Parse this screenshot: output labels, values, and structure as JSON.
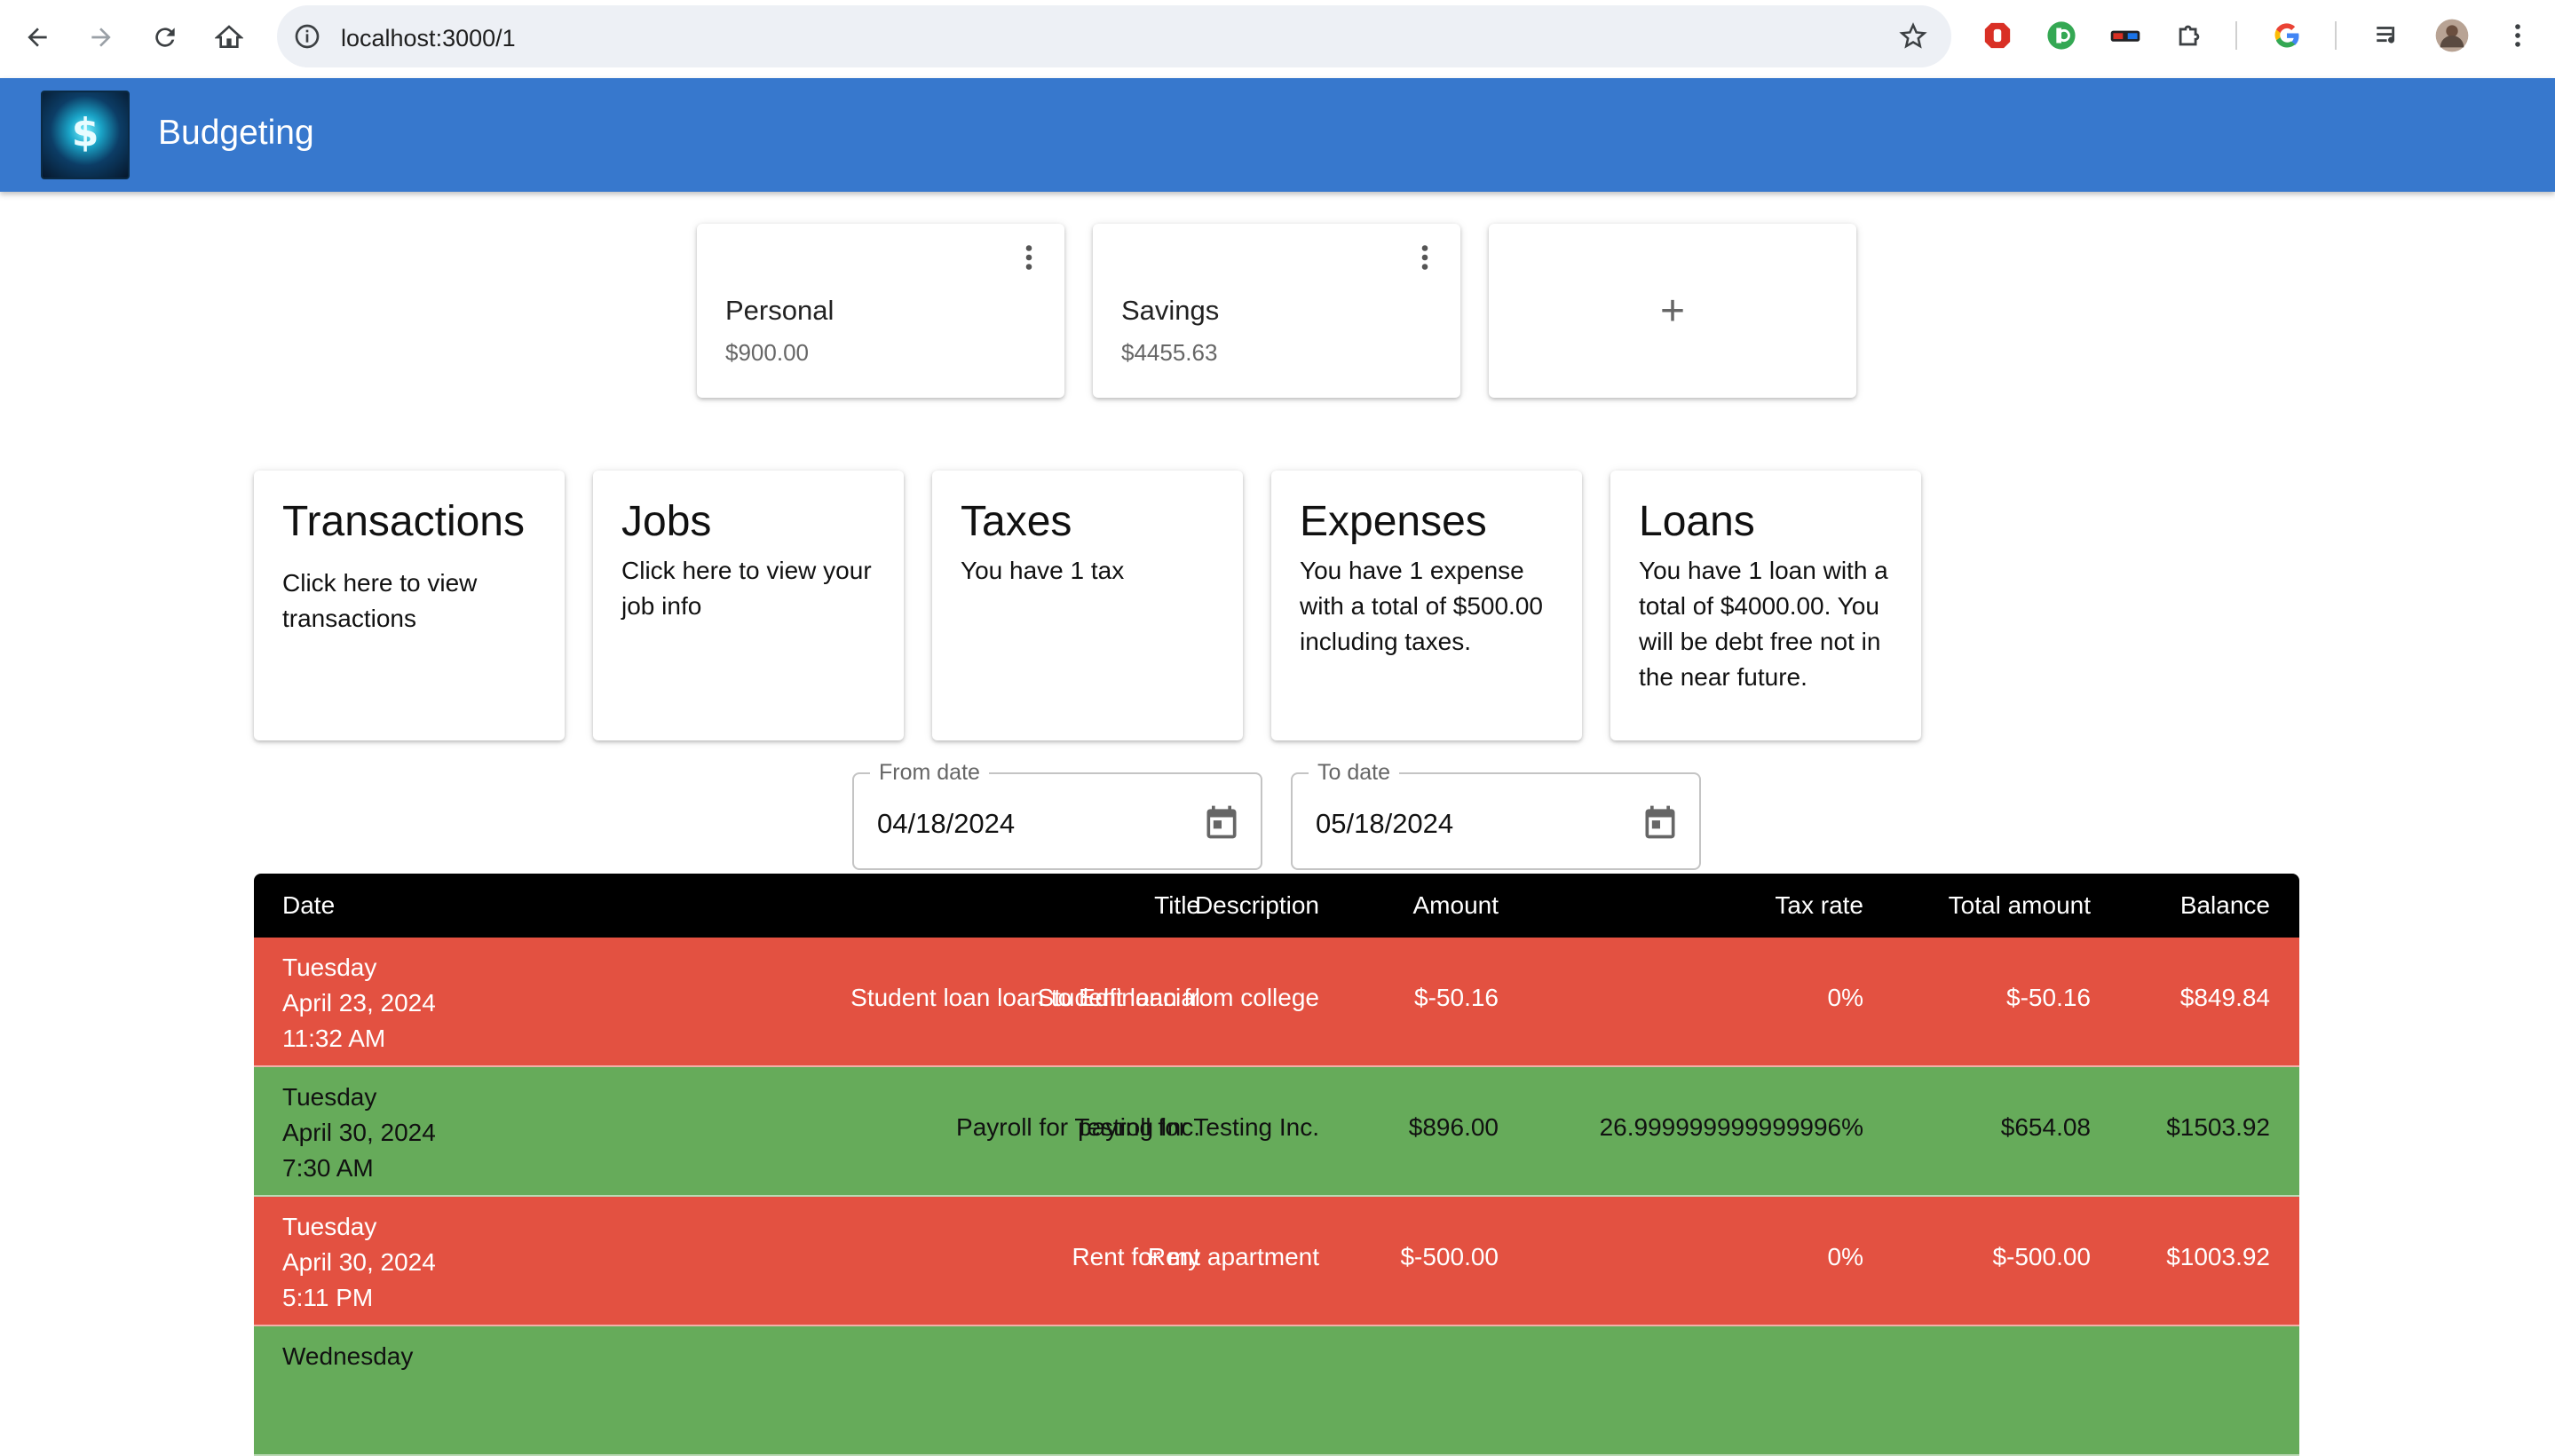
{
  "browser": {
    "url": "localhost:3000/1"
  },
  "app": {
    "title": "Budgeting",
    "logo_icon": "crystal-ball-dollar-logo"
  },
  "accounts": [
    {
      "name": "Personal",
      "balance": "$900.00"
    },
    {
      "name": "Savings",
      "balance": "$4455.63"
    }
  ],
  "add_account_label": "+",
  "sections": {
    "transactions": {
      "title": "Transactions",
      "text": "Click here to view transactions"
    },
    "jobs": {
      "title": "Jobs",
      "text": "Click here to view your job info"
    },
    "taxes": {
      "title": "Taxes",
      "text": "You have 1 tax"
    },
    "expenses": {
      "title": "Expenses",
      "text": "You have 1 expense with a total of $500.00 including taxes."
    },
    "loans": {
      "title": "Loans",
      "text": "You have 1 loan with a total of $4000.00. You will be debt free not in the near future."
    }
  },
  "filters": {
    "from": {
      "label": "From date",
      "value": "04/18/2024"
    },
    "to": {
      "label": "To date",
      "value": "05/18/2024"
    }
  },
  "table": {
    "headers": {
      "date": "Date",
      "title": "Title",
      "description": "Description",
      "amount": "Amount",
      "tax_rate": "Tax rate",
      "total": "Total amount",
      "balance": "Balance"
    },
    "rows": [
      {
        "day": "Tuesday",
        "date": "April 23, 2024",
        "time": "11:32 AM",
        "title": "Student loan loan to Edfinancial",
        "description": "Student loan from college",
        "amount": "$-50.16",
        "tax_rate": "0%",
        "total": "$-50.16",
        "balance": "$849.84",
        "kind": "neg"
      },
      {
        "day": "Tuesday",
        "date": "April 30, 2024",
        "time": "7:30 AM",
        "title": "Payroll for Testing Inc.",
        "description": "payroll for Testing Inc.",
        "amount": "$896.00",
        "tax_rate": "26.999999999999996%",
        "total": "$654.08",
        "balance": "$1503.92",
        "kind": "pos"
      },
      {
        "day": "Tuesday",
        "date": "April 30, 2024",
        "time": "5:11 PM",
        "title": "Rent",
        "description": "Rent for my apartment",
        "amount": "$-500.00",
        "tax_rate": "0%",
        "total": "$-500.00",
        "balance": "$1003.92",
        "kind": "neg"
      },
      {
        "day": "Wednesday",
        "date": "",
        "time": "",
        "title": "",
        "description": "",
        "amount": "",
        "tax_rate": "",
        "total": "",
        "balance": "",
        "kind": "pos"
      }
    ]
  },
  "colors": {
    "appbar": "#3778cd",
    "negative_row": "#e35141",
    "positive_row": "#66ab5a",
    "table_header": "#000000"
  }
}
